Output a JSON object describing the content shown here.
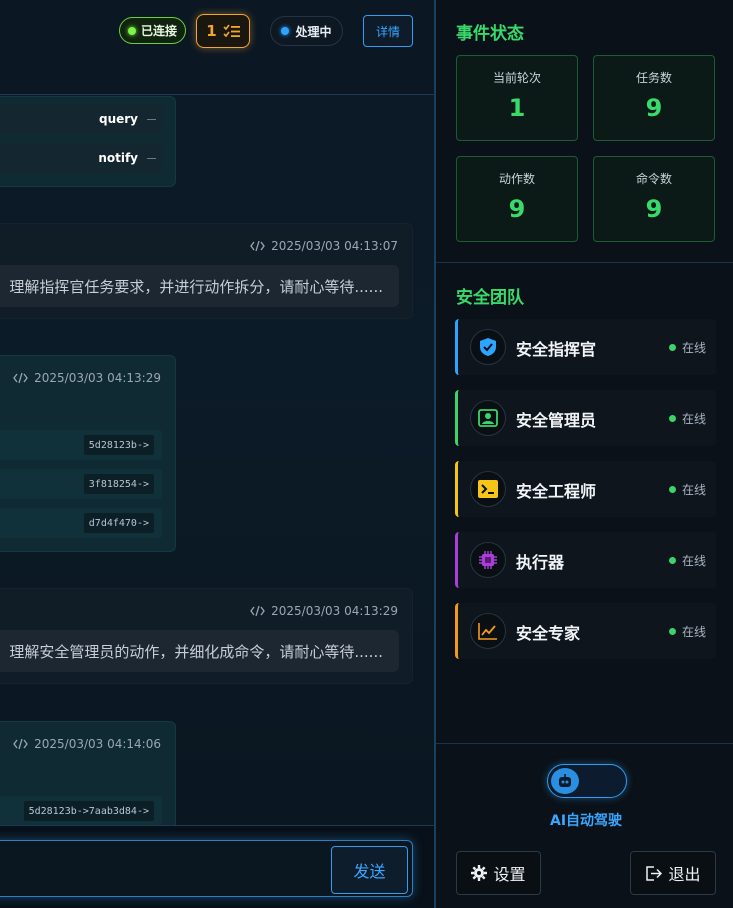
{
  "header": {
    "connected_label": "已连接",
    "task_count": "1",
    "processing_label": "处理中",
    "detail_button": "详情"
  },
  "chat": {
    "tool_chips": [
      "query",
      "notify"
    ],
    "messages": [
      {
        "timestamp": "2025/03/03 04:13:07",
        "text": "理解指挥官任务要求，并进行动作拆分，请耐心等待......"
      },
      {
        "timestamp": "2025/03/03 04:13:29",
        "hashes": [
          "5d28123b->",
          "3f818254->",
          "d7d4f470->"
        ]
      },
      {
        "timestamp": "2025/03/03 04:13:29",
        "text": "理解安全管理员的动作，并细化成命令，请耐心等待......"
      },
      {
        "timestamp": "2025/03/03 04:14:06",
        "hashes": [
          "5d28123b->7aab3d84->"
        ]
      }
    ],
    "send_button": "发送"
  },
  "sidebar": {
    "event_title": "事件状态",
    "stats": [
      {
        "label": "当前轮次",
        "value": "1"
      },
      {
        "label": "任务数",
        "value": "9"
      },
      {
        "label": "动作数",
        "value": "9"
      },
      {
        "label": "命令数",
        "value": "9"
      }
    ],
    "team_title": "安全团队",
    "agents": [
      {
        "name": "安全指挥官",
        "status": "在线",
        "icon": "shield-icon",
        "color": "#2da4ff"
      },
      {
        "name": "安全管理员",
        "status": "在线",
        "icon": "admin-icon",
        "color": "#3bd46a"
      },
      {
        "name": "安全工程师",
        "status": "在线",
        "icon": "terminal-icon",
        "color": "#f5c518"
      },
      {
        "name": "执行器",
        "status": "在线",
        "icon": "chip-icon",
        "color": "#a83fd6"
      },
      {
        "name": "安全专家",
        "status": "在线",
        "icon": "chart-icon",
        "color": "#f39a1e"
      }
    ],
    "autopilot_label": "AI自动驾驶",
    "autopilot_on": false,
    "settings_button": "设置",
    "logout_button": "退出"
  }
}
